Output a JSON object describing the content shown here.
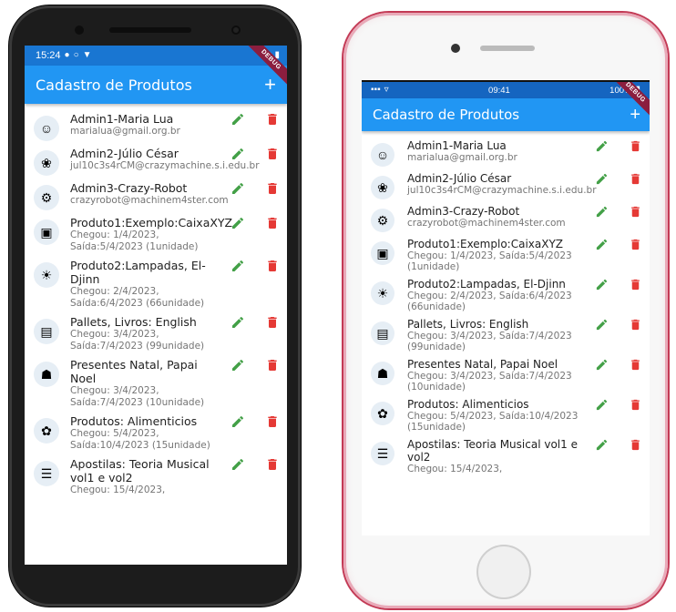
{
  "app": {
    "title": "Cadastro de Produtos",
    "add_label": "+",
    "debug_label": "DEBUG"
  },
  "colors": {
    "appbar": "#2196f3",
    "edit": "#43a047",
    "delete": "#e53935"
  },
  "android_status": {
    "time": "15:24"
  },
  "ios_status": {
    "time": "09:41",
    "battery": "100%"
  },
  "items": [
    {
      "title": "Admin1-Maria Lua",
      "subtitle": "marialua@gmail.org.br",
      "icon": "person-avatar-icon"
    },
    {
      "title": "Admin2-Júlio César",
      "subtitle": "jul10c3s4rCM@crazymachine.s.i.edu.br",
      "icon": "plant-logo-icon"
    },
    {
      "title": "Admin3-Crazy-Robot",
      "subtitle": "crazyrobot@machinem4ster.com",
      "icon": "robot-logo-icon"
    },
    {
      "title": "Produto1:Exemplo:CaixaXYZ",
      "subtitle": "Chegou: 1/4/2023, Saída:5/4/2023 (1unidade)",
      "icon": "box-icon"
    },
    {
      "title": "Produto2:Lampadas, El-Djinn",
      "subtitle": "Chegou: 2/4/2023, Saída:6/4/2023 (66unidade)",
      "icon": "lamp-icon"
    },
    {
      "title": "Pallets, Livros: English",
      "subtitle": "Chegou: 3/4/2023, Saída:7/4/2023 (99unidade)",
      "icon": "pallet-icon"
    },
    {
      "title": "Presentes Natal, Papai Noel",
      "subtitle": "Chegou: 3/4/2023, Saída:7/4/2023 (10unidade)",
      "icon": "gift-cart-icon"
    },
    {
      "title": "Produtos: Alimenticios",
      "subtitle": "Chegou: 5/4/2023, Saída:10/4/2023 (15unidade)",
      "icon": "food-basket-icon"
    },
    {
      "title": "Apostilas: Teoria Musical vol1 e vol2",
      "subtitle": "Chegou: 15/4/2023,",
      "icon": "books-icon"
    }
  ]
}
